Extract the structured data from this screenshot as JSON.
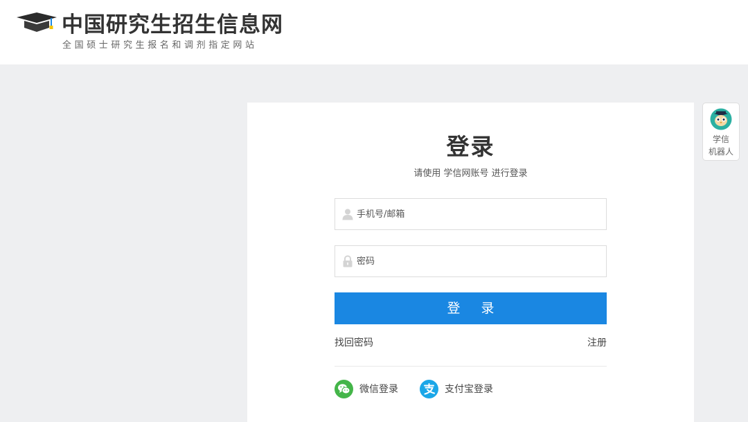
{
  "header": {
    "site_title": "中国研究生招生信息网",
    "site_subtitle": "全国硕士研究生报名和调剂指定网站",
    "logo_icon": "graduation-cap-icon"
  },
  "login": {
    "title": "登录",
    "hint": "请使用 学信网账号 进行登录",
    "username_placeholder": "手机号/邮箱",
    "password_placeholder": "密码",
    "submit_label": "登 录",
    "forgot_label": "找回密码",
    "register_label": "注册",
    "wechat_label": "微信登录",
    "alipay_label": "支付宝登录"
  },
  "robot": {
    "line1": "学信",
    "line2": "机器人"
  },
  "colors": {
    "primary": "#1a87e2",
    "wechat": "#44b549",
    "alipay": "#1ba7e8",
    "background": "#eeeff1"
  }
}
